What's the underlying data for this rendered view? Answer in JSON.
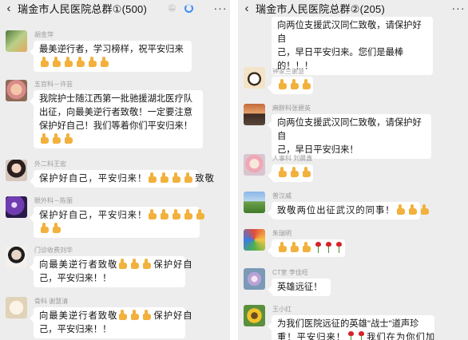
{
  "left": {
    "title": "瑞金市人民医院总群①(500)",
    "messages": [
      {
        "name": "胡金萍",
        "lines": [
          "最美逆行者，学习榜样，祝平安归来"
        ],
        "emoji_thumbs": 6,
        "emoji_roses": 0
      },
      {
        "name": "五官科－许芸",
        "lines": [
          "我院护士随江西第一批驰援湖北医疗队",
          "出征，向最美逆行者致敬！一定要注意",
          "保护好自己！我们等着你们平安归来！"
        ],
        "emoji_thumbs": 3,
        "emoji_roses": 0
      },
      {
        "name": "外二科王宏",
        "lines": [
          "保护好自己，平安归来！",
          "致敬"
        ],
        "emoji_thumbs": 4,
        "emoji_roses": 0
      },
      {
        "name": "眼外科－陈丽",
        "lines": [
          "保护好自己，平安归来！"
        ],
        "emoji_thumbs": 7,
        "emoji_roses": 0
      },
      {
        "name": "门诊收费刘华",
        "lines": [
          "向最美逆行者致敬",
          "保护好自",
          "己，平安归来！！"
        ],
        "emoji_thumbs": 3,
        "emoji_roses": 0
      },
      {
        "name": "骨科 谢慧清",
        "lines": [
          "向最美逆行者致敬",
          "保护好自",
          "己，平安归来！！"
        ],
        "emoji_thumbs": 3,
        "emoji_roses": 0
      }
    ]
  },
  "right": {
    "title": "瑞金市人民医院总群②(205)",
    "messages": [
      {
        "name": "",
        "lines": [
          "向两位支援武汉同仁致敬，请保护好自",
          "己，早日平安归来。您们是最棒",
          "的！！！"
        ],
        "emoji_thumbs": 0,
        "emoji_roses": 0
      },
      {
        "name": "钟家兰谢慧",
        "lines": [],
        "emoji_thumbs": 3,
        "emoji_roses": 0
      },
      {
        "name": "麻醉科张碧英",
        "lines": [
          "向两位支援武汉同仁致敬，请保护好自",
          "己，早日平安归来！"
        ],
        "emoji_thumbs": 0,
        "emoji_roses": 0
      },
      {
        "name": "人事科 刘晨鑫",
        "lines": [],
        "emoji_thumbs": 3,
        "emoji_roses": 0
      },
      {
        "name": "普汉威",
        "lines": [
          "致敬两位出征武汉的同事！"
        ],
        "emoji_thumbs": 3,
        "emoji_roses": 0
      },
      {
        "name": "朱瑞明",
        "lines": [],
        "emoji_thumbs": 3,
        "emoji_roses": 3
      },
      {
        "name": "CT室 李佳旺",
        "lines": [
          "英雄远征！"
        ],
        "emoji_thumbs": 0,
        "emoji_roses": 0
      },
      {
        "name": "王小红",
        "lines": [
          "为我们医院远征的英雄\"战士\"道声珍",
          "重！平安归来！",
          "我们在为你们加"
        ],
        "emoji_thumbs": 0,
        "emoji_roses": 2
      }
    ]
  },
  "icons": {
    "back": "chevron-left-icon",
    "more": "more-dots-icon",
    "mute": "bell-mute-icon",
    "loading": "loading-spinner-icon"
  }
}
